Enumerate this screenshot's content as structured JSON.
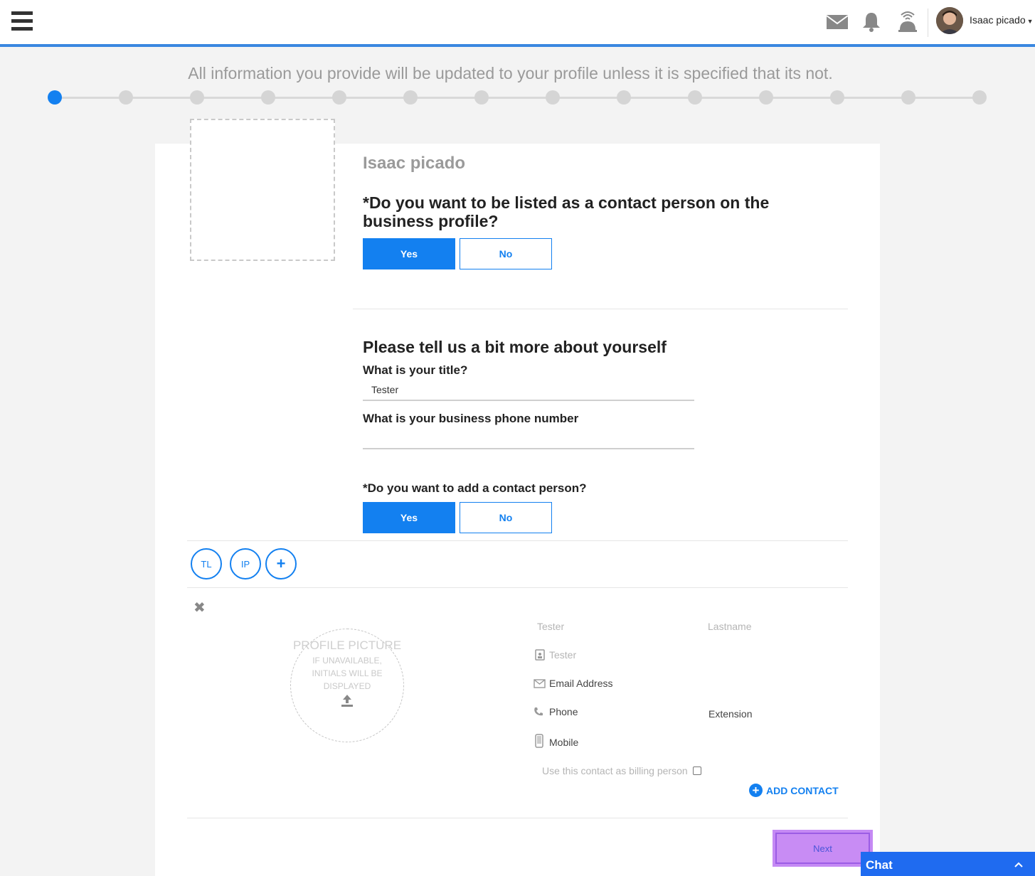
{
  "header": {
    "user_name": "Isaac picado",
    "icons": [
      "menu-icon",
      "mail-icon",
      "bell-icon",
      "service-bell-icon",
      "avatar"
    ]
  },
  "intro": "All information you provide will be updated to your profile unless it is specified that its not.",
  "stepper": {
    "total_steps": 14,
    "current_step": 1
  },
  "profile": {
    "name": "Isaac picado"
  },
  "question_contact_listed": {
    "text": "*Do you want to be listed as a contact person on the business profile?",
    "yes": "Yes",
    "no": "No",
    "selected": "Yes"
  },
  "about": {
    "title": "Please tell us a bit more about yourself",
    "title_label": "What is your title?",
    "title_value": "Tester",
    "phone_label": "What is your business phone number",
    "phone_value": ""
  },
  "question_add_contact": {
    "text": "*Do you want to add a contact person?",
    "yes": "Yes",
    "no": "No",
    "selected": "Yes"
  },
  "contacts": {
    "chips": [
      "TL",
      "IP",
      "+"
    ],
    "picture": {
      "title": "PROFILE PICTURE",
      "subtitle": "IF UNAVAILABLE, INITIALS WILL BE DISPLAYED"
    },
    "fields": {
      "firstname": "Tester",
      "lastname": "Lastname",
      "title": "Tester",
      "email": "Email Address",
      "phone": "Phone",
      "extension": "Extension",
      "mobile": "Mobile"
    },
    "billing_label": "Use this contact as billing person",
    "add_contact": "ADD CONTACT"
  },
  "next": "Next",
  "chat": {
    "label": "Chat"
  },
  "colors": {
    "accent": "#1380f0",
    "chat": "#1f6bf0",
    "highlight": "#c58af4"
  }
}
